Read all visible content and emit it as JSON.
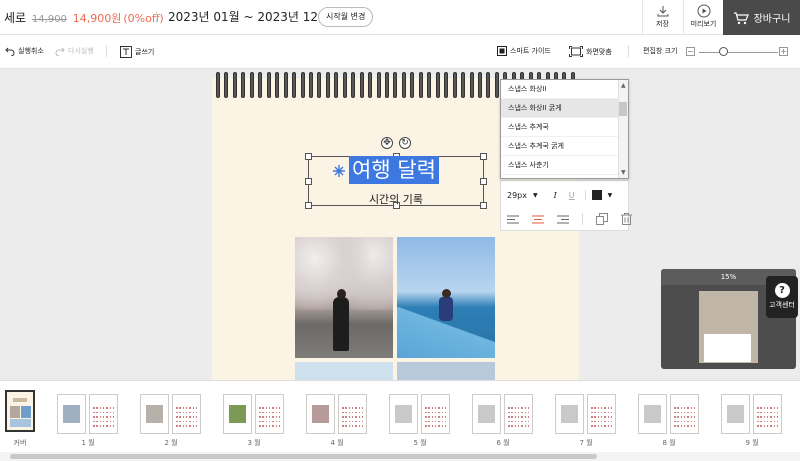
{
  "header": {
    "product_name": "세로",
    "original_price": "14,900",
    "sale_price": "14,900원",
    "discount": "(0%off)",
    "date_range": "2023년 01월 ~ 2023년 12월",
    "change_month_label": "시작월 변경",
    "save_label": "저장",
    "preview_label": "미리보기",
    "cart_label": "장바구니"
  },
  "toolbar": {
    "undo_label": "실행취소",
    "redo_label": "다시실행",
    "text_label": "글쓰기",
    "smart_guide_label": "스마트 가이드",
    "fit_screen_label": "화면맞춤",
    "edit_window_label": "편집창 크기",
    "zoom_minus": "−",
    "zoom_plus": "+",
    "zoom_level": 0.3
  },
  "canvas": {
    "title_text": "여행 달력",
    "subtitle_text": "시간의 기록"
  },
  "font_dropdown": {
    "options": [
      "스냅스 화상II",
      "스냅스 화상II 굵게",
      "스냅스 추계국",
      "스냅스 추계국 굵게",
      "스냅스 사춘기"
    ],
    "selected_index": 1
  },
  "text_panel": {
    "font_size": "29px",
    "italic": "I",
    "underline": "U",
    "text_color": "#222222"
  },
  "minimap": {
    "label": "15%"
  },
  "help": {
    "label": "고객센터",
    "icon": "?"
  },
  "pages": {
    "labels": [
      "커버",
      "1 월",
      "2 월",
      "3 월",
      "4 월",
      "5 월",
      "6 월",
      "7 월",
      "8 월",
      "9 월"
    ]
  },
  "colors": {
    "accent": "#3c78e0",
    "sale": "#f06a50",
    "page_bg": "#fbf3e3",
    "cart_bg": "#4a4a4a"
  }
}
